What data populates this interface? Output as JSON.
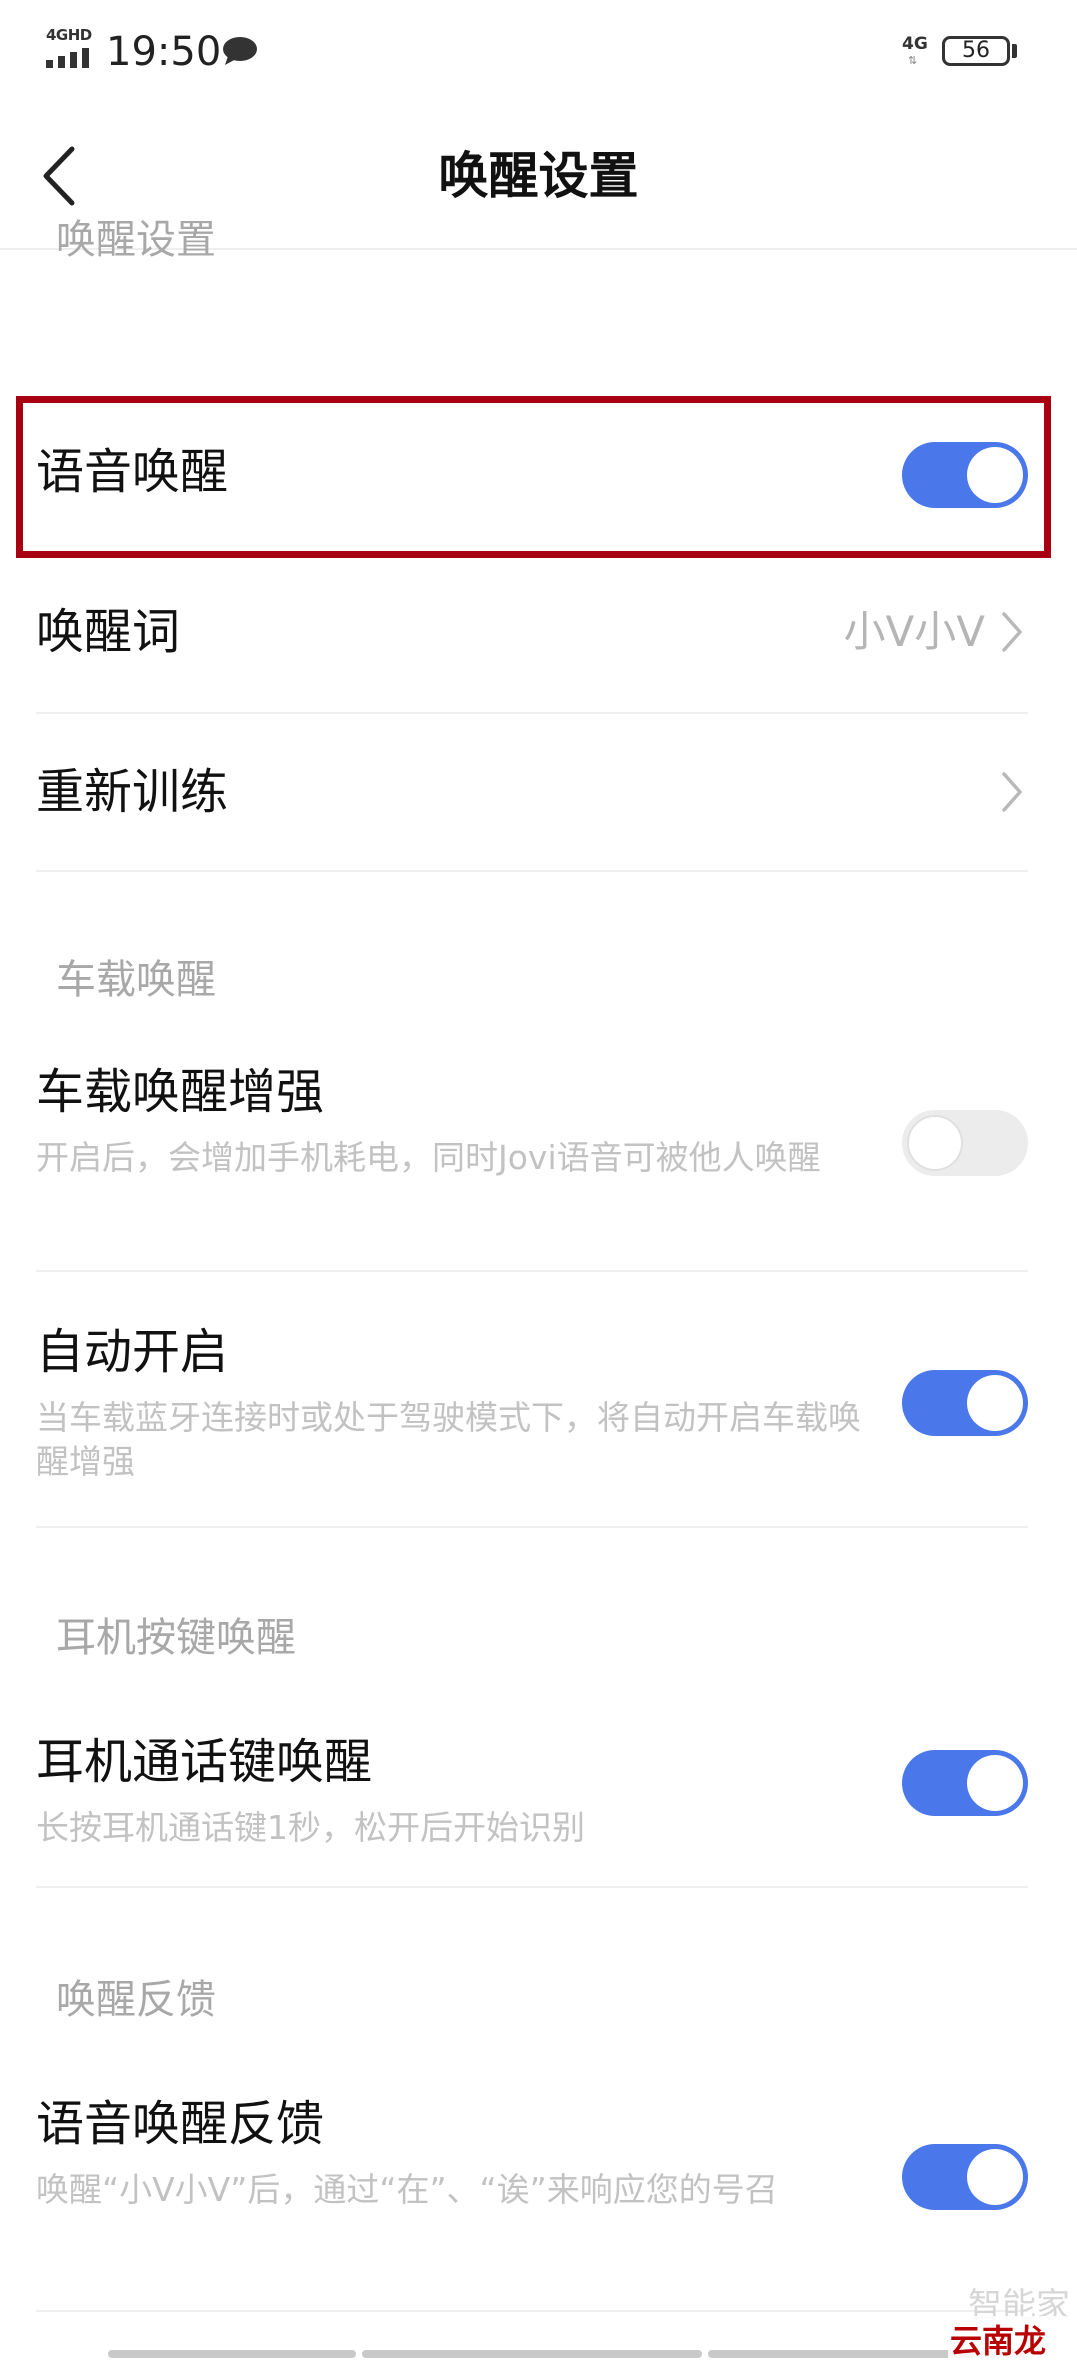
{
  "status_bar": {
    "signal_label": "4GHD",
    "time": "19:50",
    "network": "4G",
    "battery": "56"
  },
  "header": {
    "title": "唤醒设置"
  },
  "sections": {
    "wake": {
      "label": "唤醒设置",
      "voice_wake": {
        "title": "语音唤醒",
        "toggle": "on"
      },
      "wake_word": {
        "title": "唤醒词",
        "value": "小V小V"
      },
      "retrain": {
        "title": "重新训练"
      }
    },
    "car": {
      "label": "车载唤醒",
      "enhance": {
        "title": "车载唤醒增强",
        "desc": "开启后，会增加手机耗电，同时Jovi语音可被他人唤醒",
        "toggle": "off"
      },
      "auto_on": {
        "title": "自动开启",
        "desc": "当车载蓝牙连接时或处于驾驶模式下，将自动开启车载唤醒增强",
        "toggle": "on"
      }
    },
    "headset": {
      "label": "耳机按键唤醒",
      "call_key": {
        "title": "耳机通话键唤醒",
        "desc": "长按耳机通话键1秒，松开后开始识别",
        "toggle": "on"
      }
    },
    "feedback": {
      "label": "唤醒反馈",
      "voice_feedback": {
        "title": "语音唤醒反馈",
        "desc": "唤醒“小V小V”后，通过“在”、“诶”来响应您的号召",
        "toggle": "on"
      }
    }
  },
  "watermark": {
    "top": "智能家",
    "bottom": "云南龙网"
  },
  "colors": {
    "accent": "#4a77ea",
    "highlight": "#a80010",
    "section_text": "#a8a8a8"
  }
}
